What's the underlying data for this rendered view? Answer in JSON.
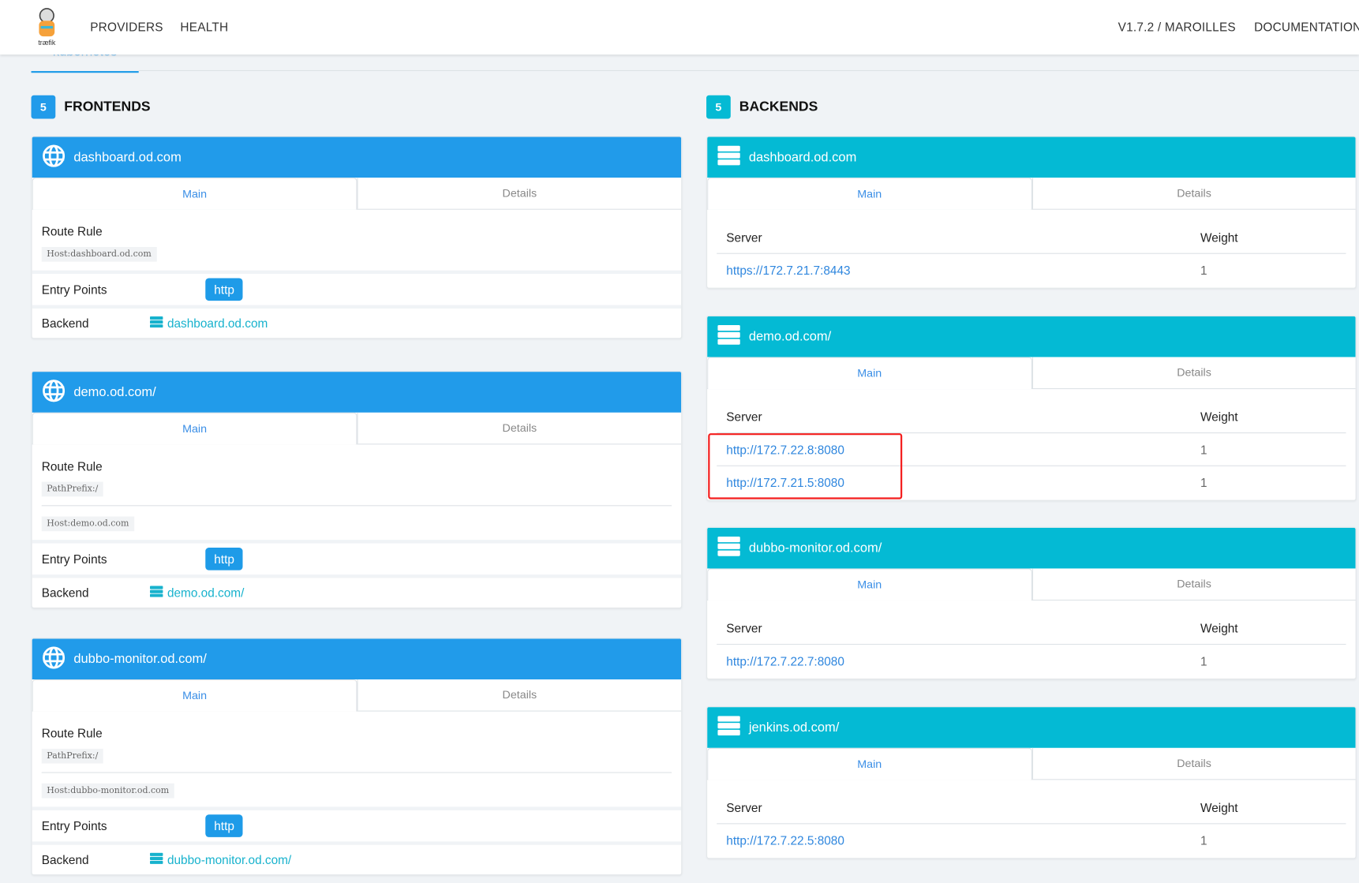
{
  "nav": {
    "items": [
      "PROVIDERS",
      "HEALTH"
    ],
    "version": "V1.7.2 / MAROILLES",
    "docs": "DOCUMENTATION",
    "logo_text": "træfik"
  },
  "provider_tab": "kubernetes",
  "colors": {
    "frontend": "#219bea",
    "backend": "#04bad4",
    "link": "#2e86de",
    "highlight": "#f41d1d"
  },
  "frontends": {
    "count": "5",
    "title": "FRONTENDS",
    "tabs": [
      "Main",
      "Details"
    ],
    "labels": {
      "route": "Route Rule",
      "entry": "Entry Points",
      "backend": "Backend"
    },
    "items": [
      {
        "name": "dashboard.od.com",
        "rules": [
          "Host:dashboard.od.com"
        ],
        "entry": "http",
        "backend": "dashboard.od.com"
      },
      {
        "name": "demo.od.com/",
        "rules": [
          "PathPrefix:/",
          "Host:demo.od.com"
        ],
        "entry": "http",
        "backend": "demo.od.com/"
      },
      {
        "name": "dubbo-monitor.od.com/",
        "rules": [
          "PathPrefix:/",
          "Host:dubbo-monitor.od.com"
        ],
        "entry": "http",
        "backend": "dubbo-monitor.od.com/"
      }
    ]
  },
  "backends": {
    "count": "5",
    "title": "BACKENDS",
    "tabs": [
      "Main",
      "Details"
    ],
    "columns": [
      "Server",
      "Weight"
    ],
    "items": [
      {
        "name": "dashboard.od.com",
        "servers": [
          {
            "url": "https://172.7.21.7:8443",
            "weight": "1"
          }
        ]
      },
      {
        "name": "demo.od.com/",
        "servers": [
          {
            "url": "http://172.7.22.8:8080",
            "weight": "1"
          },
          {
            "url": "http://172.7.21.5:8080",
            "weight": "1"
          }
        ]
      },
      {
        "name": "dubbo-monitor.od.com/",
        "servers": [
          {
            "url": "http://172.7.22.7:8080",
            "weight": "1"
          }
        ]
      },
      {
        "name": "jenkins.od.com/",
        "servers": [
          {
            "url": "http://172.7.22.5:8080",
            "weight": "1"
          }
        ]
      }
    ]
  }
}
